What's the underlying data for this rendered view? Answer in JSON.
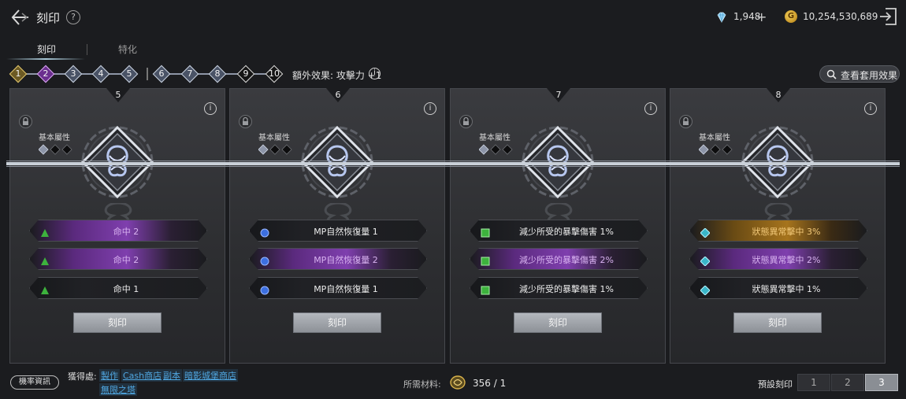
{
  "header": {
    "title": "刻印",
    "help": "?",
    "diamonds": "1,948",
    "plus": "+",
    "gold_symbol": "G",
    "gold": "10,254,530,689"
  },
  "tabs": [
    {
      "label": "刻印",
      "active": true
    },
    {
      "label": "特化",
      "active": false
    }
  ],
  "slots": [
    {
      "num": "1",
      "state": "gold"
    },
    {
      "num": "2",
      "state": "purple"
    },
    {
      "num": "3",
      "state": "normal"
    },
    {
      "num": "4",
      "state": "normal"
    },
    {
      "num": "5",
      "state": "normal"
    },
    {
      "num": "6",
      "state": "normal"
    },
    {
      "num": "7",
      "state": "normal"
    },
    {
      "num": "8",
      "state": "normal"
    },
    {
      "num": "9",
      "state": "dark"
    },
    {
      "num": "10",
      "state": "dark"
    }
  ],
  "bonus": {
    "text": "額外效果: 攻擊力 +1",
    "info": "i"
  },
  "view_set_button": "查看套用效果",
  "cards": [
    {
      "num": "5",
      "base_label": "基本屬性",
      "info": "i",
      "stats": [
        {
          "text": "命中 2",
          "tier": "purple",
          "icon": "triangle-icon"
        },
        {
          "text": "命中 2",
          "tier": "purple",
          "icon": "triangle-icon"
        },
        {
          "text": "命中 1",
          "tier": "normal",
          "icon": "triangle-icon"
        }
      ],
      "button": "刻印"
    },
    {
      "num": "6",
      "base_label": "基本屬性",
      "info": "i",
      "stats": [
        {
          "text": "MP自然恢復量 1",
          "tier": "normal",
          "icon": "circle-icon"
        },
        {
          "text": "MP自然恢復量 2",
          "tier": "purple",
          "icon": "circle-icon"
        },
        {
          "text": "MP自然恢復量 1",
          "tier": "normal",
          "icon": "circle-icon"
        }
      ],
      "button": "刻印"
    },
    {
      "num": "7",
      "base_label": "基本屬性",
      "info": "i",
      "stats": [
        {
          "text": "減少所受的暴擊傷害 1%",
          "tier": "normal",
          "icon": "square-icon"
        },
        {
          "text": "減少所受的暴擊傷害 2%",
          "tier": "purple",
          "icon": "square-icon"
        },
        {
          "text": "減少所受的暴擊傷害 1%",
          "tier": "normal",
          "icon": "square-icon"
        }
      ],
      "button": "刻印"
    },
    {
      "num": "8",
      "base_label": "基本屬性",
      "info": "i",
      "stats": [
        {
          "text": "狀態異常擊中 3%",
          "tier": "gold",
          "icon": "diamond-icon"
        },
        {
          "text": "狀態異常擊中 2%",
          "tier": "purple",
          "icon": "diamond-icon"
        },
        {
          "text": "狀態異常擊中 1%",
          "tier": "normal",
          "icon": "diamond-icon"
        }
      ],
      "button": "刻印"
    }
  ],
  "footer": {
    "rate_button": "機率資訊",
    "source_label": "獲得處:",
    "sources": [
      "製作",
      "Cash商店",
      "副本",
      "暗影城堡商店",
      "無限之塔"
    ],
    "material_label": "所需材料:",
    "material_count": "356 / 1",
    "preset_label": "預設刻印",
    "presets": [
      "1",
      "2",
      "3"
    ],
    "active_preset": "3"
  },
  "colors": {
    "purple": "#9c3fd0",
    "gold": "#c6901f",
    "green_icon": "#3db23d",
    "blue_icon": "#3c6fe0",
    "cyan_icon": "#3ab6c8",
    "link": "#4fa6e0"
  }
}
